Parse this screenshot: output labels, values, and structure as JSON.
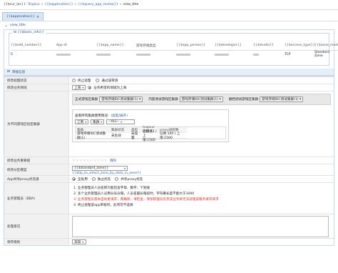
{
  "breadcrumb": {
    "home": "{{$cur_loc}}:",
    "app": "Tcaplus",
    "app_name": "{{$application}}",
    "review": "{{$query_app_review}}",
    "view": "view_title"
  },
  "tab": {
    "label": "{{$application}}",
    "close": "×"
  },
  "page_title": "view_title",
  "basic_info": {
    "legend": "{{$basic_info}}",
    "headers": [
      "{{$odd_number}}",
      "App Id",
      "{{$app_name}}",
      "游戏存储类型",
      "{{$app_person}}",
      "{{$developer}}",
      "{{$studio}}",
      "{{$access_type}}",
      "{{$zone_model}}"
    ],
    "values": [
      "5",
      "",
      "",
      "",
      "",
      "",
      "",
      "TCP",
      "Standard Zone"
    ]
  },
  "review_section": {
    "title": "审核信息"
  },
  "form": {
    "status": {
      "label": "修改处理状态",
      "opt1": "终止处理",
      "opt2": "通过该审请"
    },
    "region": {
      "label": "修改业务地域",
      "select": "上海",
      "hint": "业务希望的地域为上海"
    },
    "cluster": {
      "label": "为不同游戏区指定集群",
      "g1_label": "正式游戏区集群",
      "g1_value": "游戏存储IDC测试集群(1)",
      "g2_label": "内部测试游戏区集群",
      "g2_value": "游戏存储IDC测试集群(1)",
      "g3_label": "删档测试游戏区集群",
      "g3_value": "游戏存储IDC测试集群(1)",
      "inner_title": "查看所有集群使用情况:",
      "inner_link": "(收起/展开)",
      "filter1": "江南",
      "filter2": "集群",
      "filter3": "--ALL--",
      "headers": [
        "集群",
        "集群状态",
        "类型",
        "tcapsvr进程数",
        "proxy进程数"
      ],
      "row": [
        "游戏存储IDC测试集群(1)",
        "未生效",
        "未设置",
        "已用 22 / 上限:1500",
        "已用 165 / 上限:1500"
      ]
    },
    "importance": {
      "label": "修改业务重要级",
      "clear": "清除"
    },
    "zone_model": {
      "label": "修改分区模型",
      "select": "{{$standard_zone}}",
      "link": "{{$tip_to_select_zone_by_data_in_zone}}"
    },
    "proxy": {
      "label": "App共享proxy优先级",
      "opt1": "全处用",
      "opt2": "独占优先",
      "opt3": "共享proxy优先"
    },
    "dba": {
      "label": "业务管理员（DBA）",
      "notes": [
        "业务管理员人员名称只能包含字母、数字、下划线",
        "多个业务管理员人员用分号分隔，人员名最长每段时，字符串长度不能大于1000",
        "业务管理员基本自动重请求，需确保，请检查，添加管理员负责该业务将无法处理该服务请求请求",
        "终止处理该app审核时，此项可不选择"
      ]
    },
    "remark": {
      "label": "处理意见"
    },
    "priority": {
      "label": "保存级别",
      "select": "未知"
    }
  }
}
